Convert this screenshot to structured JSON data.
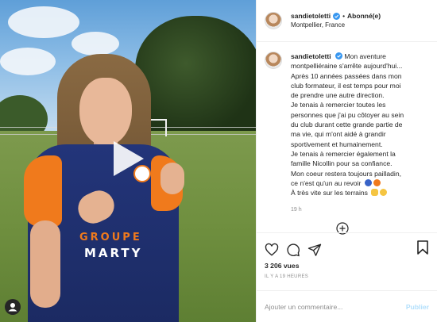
{
  "header": {
    "username": "sandietoletti",
    "separator": "•",
    "follow_label": "Abonné(e)",
    "location": "Montpellier, France"
  },
  "caption": {
    "username": "sandietoletti",
    "lines": [
      "Mon aventure",
      "montpelliéraine s'arrête aujourd'hui...",
      "Après 10 années passées dans mon",
      "club formateur, il est temps pour moi",
      "de prendre une autre direction.",
      "Je tenais à remercier toutes les",
      "personnes que j'ai pu côtoyer au sein",
      "du club durant cette grande partie de",
      "ma vie, qui m'ont aidé à grandir",
      "sportivement et humainement.",
      "Je tenais à remercier également la",
      "famille Nicollin pour sa confiance.",
      "Mon coeur restera toujours pailladin,",
      "ce n'est qu'un au revoir",
      "À très vite sur les terrains"
    ],
    "time": "19 h"
  },
  "media": {
    "sponsor_line1": "GROUPE",
    "sponsor_line2": "MARTY"
  },
  "stats": {
    "views": "3 206 vues",
    "ago": "IL Y A 19 HEURES"
  },
  "comment_box": {
    "placeholder": "Ajouter un commentaire...",
    "post_label": "Publier"
  },
  "colors": {
    "verified": "#3897f0",
    "blue_heart": "#3863c7",
    "orange_heart": "#f07a1c",
    "publish": "#b2dffc"
  },
  "icons": [
    "play-icon",
    "verified-icon",
    "heart-icon",
    "comment-icon",
    "share-icon",
    "bookmark-icon",
    "more-comments-icon",
    "user-icon"
  ]
}
